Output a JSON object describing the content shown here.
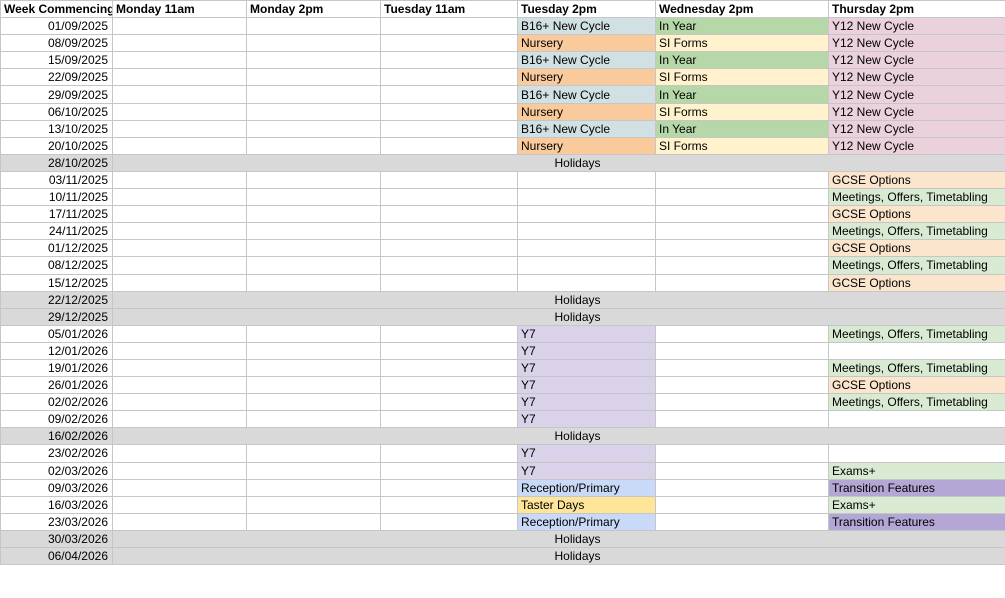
{
  "headers": [
    "Week Commencing",
    "Monday 11am",
    "Monday 2pm",
    "Tuesday 11am",
    "Tuesday 2pm",
    "Wednesday 2pm",
    "Thursday 2pm"
  ],
  "holiday_label": "Holidays",
  "colors": {
    "b16": "#d0e0e3",
    "nursery": "#f9cb9c",
    "inyear": "#b6d7a8",
    "siforms": "#fff2cc",
    "y12": "#ead1dc",
    "gcse": "#fce5cd",
    "meetings": "#d9ead3",
    "y7": "#d9d2e9",
    "exams": "#d9ead3",
    "transition": "#b4a7d6",
    "reception": "#c9daf8",
    "taster": "#ffe599",
    "holiday": "#d9d9d9"
  },
  "rows": [
    {
      "week": "01/09/2025",
      "tue2": "B16+ New Cycle",
      "wed2": "In Year",
      "thu2": "Y12 New Cycle"
    },
    {
      "week": "08/09/2025",
      "tue2": "Nursery",
      "wed2": "SI Forms",
      "thu2": "Y12 New Cycle"
    },
    {
      "week": "15/09/2025",
      "tue2": "B16+ New Cycle",
      "wed2": "In Year",
      "thu2": "Y12 New Cycle"
    },
    {
      "week": "22/09/2025",
      "tue2": "Nursery",
      "wed2": "SI Forms",
      "thu2": "Y12 New Cycle"
    },
    {
      "week": "29/09/2025",
      "tue2": "B16+ New Cycle",
      "wed2": "In Year",
      "thu2": "Y12 New Cycle"
    },
    {
      "week": "06/10/2025",
      "tue2": "Nursery",
      "wed2": "SI Forms",
      "thu2": "Y12 New Cycle"
    },
    {
      "week": "13/10/2025",
      "tue2": "B16+ New Cycle",
      "wed2": "In Year",
      "thu2": "Y12 New Cycle"
    },
    {
      "week": "20/10/2025",
      "tue2": "Nursery",
      "wed2": "SI Forms",
      "thu2": "Y12 New Cycle"
    },
    {
      "week": "28/10/2025",
      "holiday": true
    },
    {
      "week": "03/11/2025",
      "thu2": "GCSE Options"
    },
    {
      "week": "10/11/2025",
      "thu2": "Meetings, Offers, Timetabling"
    },
    {
      "week": "17/11/2025",
      "thu2": "GCSE Options"
    },
    {
      "week": "24/11/2025",
      "thu2": "Meetings, Offers, Timetabling"
    },
    {
      "week": "01/12/2025",
      "thu2": "GCSE Options"
    },
    {
      "week": "08/12/2025",
      "thu2": "Meetings, Offers, Timetabling"
    },
    {
      "week": "15/12/2025",
      "thu2": "GCSE Options"
    },
    {
      "week": "22/12/2025",
      "holiday": true
    },
    {
      "week": "29/12/2025",
      "holiday": true
    },
    {
      "week": "05/01/2026",
      "tue2": "Y7",
      "thu2": "Meetings, Offers, Timetabling"
    },
    {
      "week": "12/01/2026",
      "tue2": "Y7"
    },
    {
      "week": "19/01/2026",
      "tue2": "Y7",
      "thu2": "Meetings, Offers, Timetabling"
    },
    {
      "week": "26/01/2026",
      "tue2": "Y7",
      "thu2": "GCSE Options"
    },
    {
      "week": "02/02/2026",
      "tue2": "Y7",
      "thu2": "Meetings, Offers, Timetabling"
    },
    {
      "week": "09/02/2026",
      "tue2": "Y7"
    },
    {
      "week": "16/02/2026",
      "holiday": true
    },
    {
      "week": "23/02/2026",
      "tue2": "Y7"
    },
    {
      "week": "02/03/2026",
      "tue2": "Y7",
      "thu2": "Exams+"
    },
    {
      "week": "09/03/2026",
      "tue2": "Reception/Primary",
      "thu2": "Transition Features"
    },
    {
      "week": "16/03/2026",
      "tue2": "Taster Days",
      "thu2": "Exams+"
    },
    {
      "week": "23/03/2026",
      "tue2": "Reception/Primary",
      "thu2": "Transition Features"
    },
    {
      "week": "30/03/2026",
      "holiday": true
    },
    {
      "week": "06/04/2026",
      "holiday": true
    }
  ]
}
